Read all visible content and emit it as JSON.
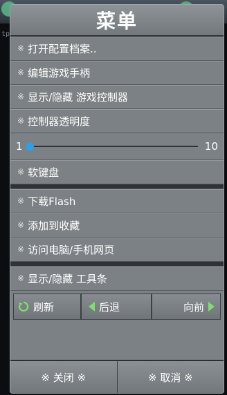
{
  "background": {
    "partial_text": "tp"
  },
  "menu": {
    "title": "菜单",
    "items": [
      {
        "mark": "※",
        "label": "打开配置档案.."
      },
      {
        "mark": "※",
        "label": "编辑游戏手柄"
      },
      {
        "mark": "※",
        "label": "显示/隐藏 游戏控制器"
      },
      {
        "mark": "※",
        "label": "控制器透明度"
      }
    ],
    "opacity_slider": {
      "min": "1",
      "max": "10",
      "value": 1
    },
    "items2": [
      {
        "mark": "※",
        "label": "软键盘"
      }
    ],
    "items3": [
      {
        "mark": "※",
        "label": "下载Flash"
      },
      {
        "mark": "※",
        "label": "添加到收藏"
      },
      {
        "mark": "※",
        "label": "访问电脑/手机网页"
      }
    ],
    "items4": [
      {
        "mark": "※",
        "label": "显示/隐藏 工具条"
      }
    ],
    "nav": {
      "refresh": "刷新",
      "back": "后退",
      "forward": "向前"
    },
    "bottom": {
      "close": "※ 关闭 ※",
      "cancel": "※ 取消 ※"
    }
  },
  "colors": {
    "accent": "#2d9fe5",
    "nav_arrow": "#7ee06a"
  }
}
